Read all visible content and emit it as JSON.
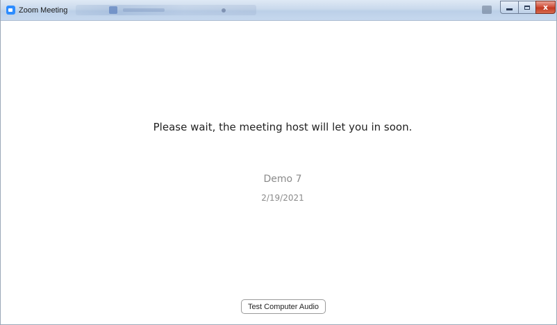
{
  "window": {
    "title": "Zoom Meeting",
    "controls": {
      "minimize": "minimize-icon",
      "maximize": "maximize-icon",
      "close": "close-icon",
      "close_glyph": "x"
    },
    "app_icon": "zoom-camera-icon"
  },
  "main": {
    "wait_message": "Please wait, the meeting host will let you in soon.",
    "meeting_name": "Demo 7",
    "meeting_date": "2/19/2021",
    "test_audio_label": "Test Computer Audio"
  },
  "colors": {
    "accent": "#2d8cff",
    "close_button": "#c23a22",
    "primary_text": "#222222",
    "secondary_text": "#8a8a8a"
  }
}
